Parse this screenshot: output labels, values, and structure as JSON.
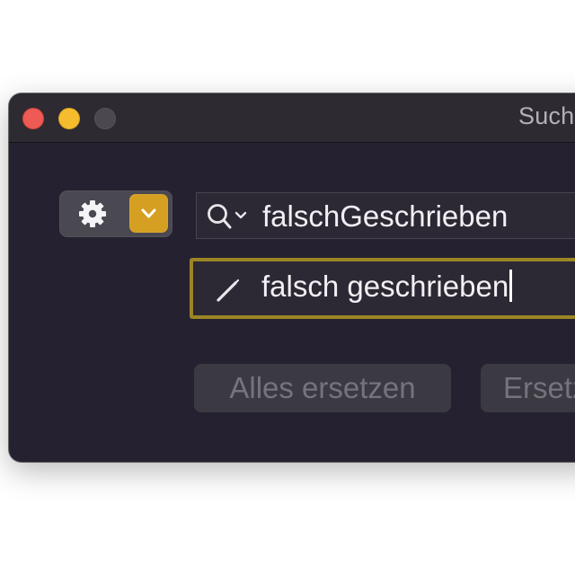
{
  "window": {
    "title": "Suche"
  },
  "options": {
    "gear_icon": "gear-icon",
    "chevron_icon": "chevron-down-icon",
    "accent_color": "#d59f21"
  },
  "search": {
    "icon": "search-icon",
    "value": "falschGeschrieben"
  },
  "replace": {
    "icon": "pencil-icon",
    "value": "falsch geschrieben",
    "focus_color": "#9c8524"
  },
  "buttons": {
    "replace_all_label": "Alles ersetzen",
    "replace_label": "Ersetzen"
  }
}
